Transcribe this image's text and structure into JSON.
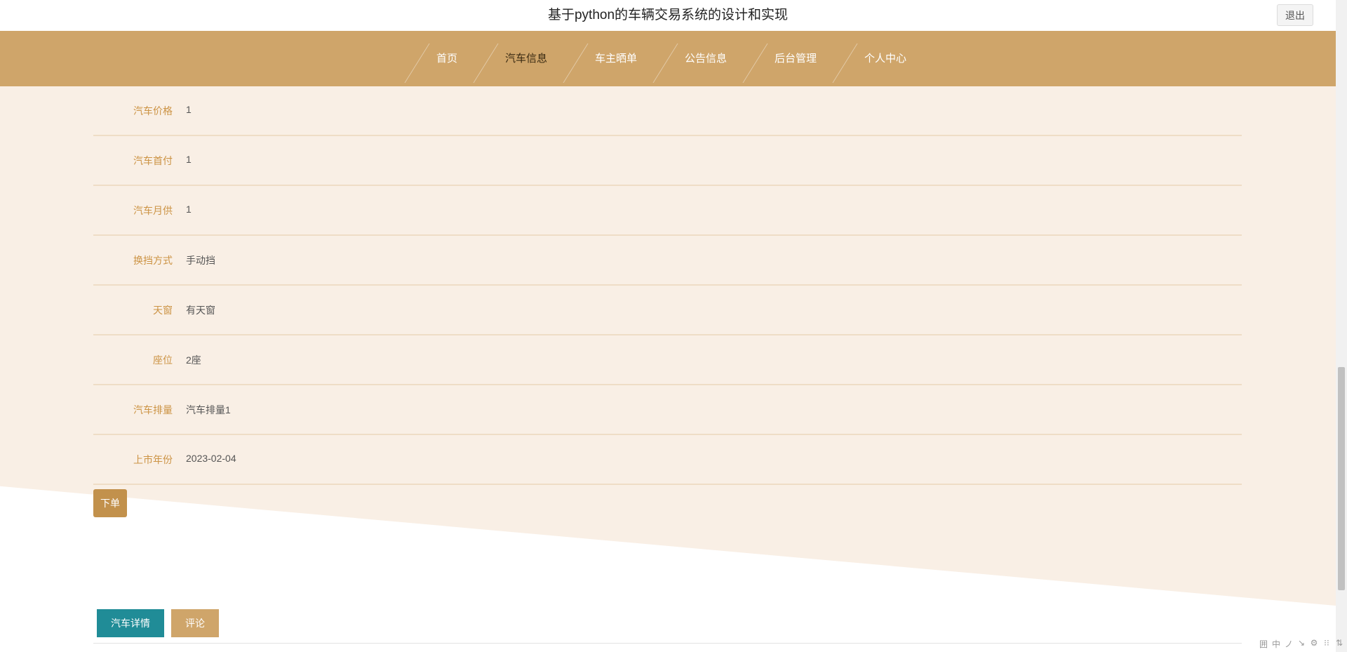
{
  "header": {
    "title": "基于python的车辆交易系统的设计和实现",
    "logout_label": "退出"
  },
  "nav": {
    "items": [
      {
        "label": "首页"
      },
      {
        "label": "汽车信息"
      },
      {
        "label": "车主晒单"
      },
      {
        "label": "公告信息"
      },
      {
        "label": "后台管理"
      },
      {
        "label": "个人中心"
      }
    ],
    "active_index": 1
  },
  "details": [
    {
      "label": "汽车价格",
      "value": "1"
    },
    {
      "label": "汽车首付",
      "value": "1"
    },
    {
      "label": "汽车月供",
      "value": "1"
    },
    {
      "label": "换挡方式",
      "value": "手动挡"
    },
    {
      "label": "天窗",
      "value": "有天窗"
    },
    {
      "label": "座位",
      "value": "2座"
    },
    {
      "label": "汽车排量",
      "value": "汽车排量1"
    },
    {
      "label": "上市年份",
      "value": "2023-02-04"
    }
  ],
  "order_label": "下单",
  "tabs": [
    {
      "label": "汽车详情"
    },
    {
      "label": "评论"
    }
  ],
  "ime": [
    "囲",
    "中",
    "ノ",
    "↘",
    "⚙",
    "⁝⁝",
    "⇅"
  ],
  "colors": {
    "nav_bg": "#cfa56a",
    "content_bg": "#f9efe5",
    "label": "#cc9344",
    "order_button": "#c2914c",
    "tab_active": "#208c97"
  }
}
